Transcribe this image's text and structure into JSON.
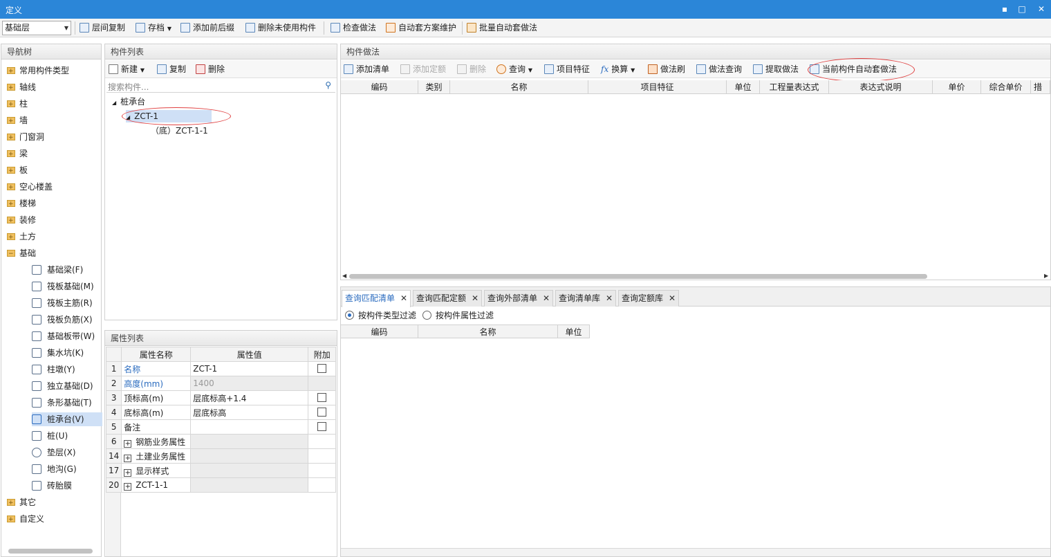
{
  "window": {
    "title": "定义",
    "minimize": "▪",
    "maximize": "□",
    "close": "✕"
  },
  "toolbar": {
    "floor_value": "基础层",
    "items": [
      "层间复制",
      "存档",
      "添加前后缀",
      "删除未使用构件",
      "检查做法",
      "自动套方案维护",
      "批量自动套做法"
    ]
  },
  "nav": {
    "title": "导航树",
    "items": [
      "常用构件类型",
      "轴线",
      "柱",
      "墙",
      "门窗洞",
      "梁",
      "板",
      "空心楼盖",
      "楼梯",
      "装修",
      "土方",
      "基础"
    ],
    "sub_items": [
      "基础梁(F)",
      "筏板基础(M)",
      "筏板主筋(R)",
      "筏板负筋(X)",
      "基础板带(W)",
      "集水坑(K)",
      "柱墩(Y)",
      "独立基础(D)",
      "条形基础(T)",
      "桩承台(V)",
      "桩(U)",
      "垫层(X)",
      "地沟(G)",
      "砖胎膜"
    ],
    "tail_items": [
      "其它",
      "自定义"
    ]
  },
  "complist": {
    "title": "构件列表",
    "new": "新建",
    "copy": "复制",
    "delete": "删除",
    "search_placeholder": "搜索构件...",
    "tree_root": "桩承台",
    "tree_child": "ZCT-1",
    "tree_leaf": "（底）ZCT-1-1"
  },
  "props": {
    "title": "属性列表",
    "headers": [
      "属性名称",
      "属性值",
      "附加"
    ],
    "rows": [
      {
        "num": "1",
        "name": "名称",
        "value": "ZCT-1"
      },
      {
        "num": "2",
        "name": "高度(mm)",
        "value": "1400"
      },
      {
        "num": "3",
        "name": "顶标高(m)",
        "value": "层底标高+1.4"
      },
      {
        "num": "4",
        "name": "底标高(m)",
        "value": "层底标高"
      },
      {
        "num": "5",
        "name": "备注",
        "value": ""
      },
      {
        "num": "6",
        "name": "钢筋业务属性",
        "value": ""
      },
      {
        "num": "14",
        "name": "土建业务属性",
        "value": ""
      },
      {
        "num": "17",
        "name": "显示样式",
        "value": ""
      },
      {
        "num": "20",
        "name": "ZCT-1-1",
        "value": ""
      }
    ]
  },
  "method": {
    "title": "构件做法",
    "buttons": [
      "添加清单",
      "添加定额",
      "删除",
      "查询",
      "项目特征",
      "换算",
      "做法刷",
      "做法查询",
      "提取做法",
      "当前构件自动套做法"
    ],
    "columns": [
      "编码",
      "类别",
      "名称",
      "项目特征",
      "单位",
      "工程量表达式",
      "表达式说明",
      "单价",
      "综合单价",
      "措施"
    ]
  },
  "query": {
    "tabs": [
      "查询匹配清单",
      "查询匹配定额",
      "查询外部清单",
      "查询清单库",
      "查询定额库"
    ],
    "filter_type": "按构件类型过滤",
    "filter_attr": "按构件属性过滤",
    "columns": [
      "编码",
      "名称",
      "单位"
    ]
  }
}
